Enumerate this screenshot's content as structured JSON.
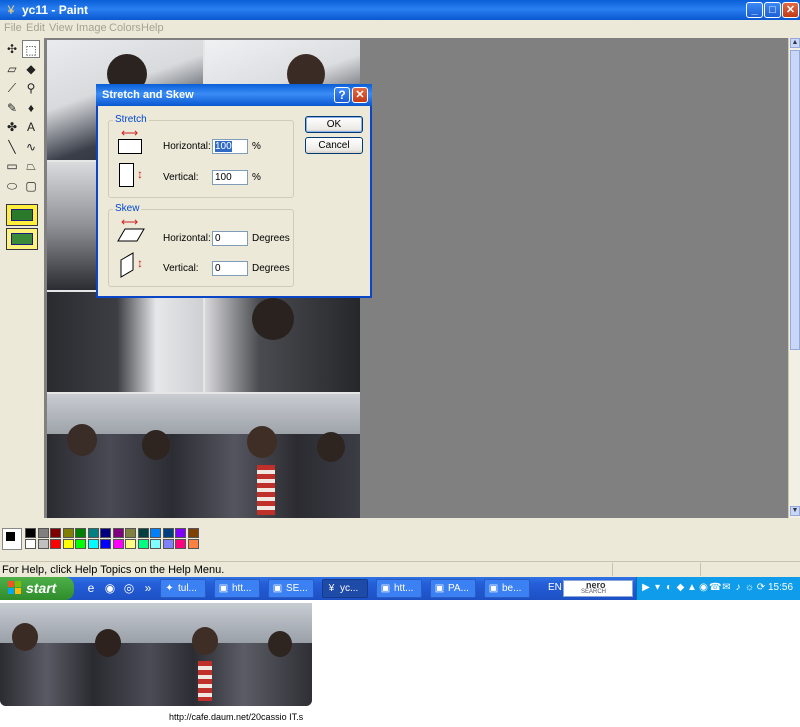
{
  "window": {
    "title": "yc11 - Paint",
    "buttons": {
      "minimize": "_",
      "maximize": "□",
      "close": "✕"
    }
  },
  "menubar": {
    "items": [
      "File",
      "Edit",
      "View",
      "Image",
      "Colors",
      "Help"
    ]
  },
  "toolbox": {
    "tools": [
      {
        "name": "free-form-select-icon",
        "glyph": "✣"
      },
      {
        "name": "select-icon",
        "glyph": "⬚"
      },
      {
        "name": "eraser-icon",
        "glyph": "▱"
      },
      {
        "name": "fill-bucket-icon",
        "glyph": "◆"
      },
      {
        "name": "color-picker-icon",
        "glyph": "⟋"
      },
      {
        "name": "magnifier-icon",
        "glyph": "⚲"
      },
      {
        "name": "pencil-icon",
        "glyph": "✎"
      },
      {
        "name": "brush-icon",
        "glyph": "♦"
      },
      {
        "name": "airbrush-icon",
        "glyph": "✤"
      },
      {
        "name": "text-icon",
        "glyph": "A"
      },
      {
        "name": "line-icon",
        "glyph": "╲"
      },
      {
        "name": "curve-icon",
        "glyph": "∿"
      },
      {
        "name": "rectangle-icon",
        "glyph": "▭"
      },
      {
        "name": "polygon-icon",
        "glyph": "⏢"
      },
      {
        "name": "ellipse-icon",
        "glyph": "⬭"
      },
      {
        "name": "rounded-rectangle-icon",
        "glyph": "▢"
      }
    ]
  },
  "palette": {
    "colors_row1": [
      "#000000",
      "#808080",
      "#800000",
      "#808000",
      "#008000",
      "#008080",
      "#000080",
      "#800080",
      "#808040",
      "#004040",
      "#0080ff",
      "#004080",
      "#8000ff",
      "#804000"
    ],
    "colors_row2": [
      "#ffffff",
      "#c0c0c0",
      "#ff0000",
      "#ffff00",
      "#00ff00",
      "#00ffff",
      "#0000ff",
      "#ff00ff",
      "#ffff80",
      "#00ff80",
      "#80ffff",
      "#8080ff",
      "#ff0080",
      "#ff8040"
    ]
  },
  "status": {
    "text": "For Help, click Help Topics on the Help Menu."
  },
  "dialog": {
    "title": "Stretch and Skew",
    "help_glyph": "?",
    "close_glyph": "✕",
    "stretch": {
      "group_label": "Stretch",
      "horizontal_label": "Horizontal:",
      "horizontal_value": "100",
      "horizontal_unit": "%",
      "vertical_label": "Vertical:",
      "vertical_value": "100",
      "vertical_unit": "%"
    },
    "skew": {
      "group_label": "Skew",
      "horizontal_label": "Horizontal:",
      "horizontal_value": "0",
      "horizontal_unit": "Degrees",
      "vertical_label": "Vertical:",
      "vertical_value": "0",
      "vertical_unit": "Degrees"
    },
    "ok_label": "OK",
    "cancel_label": "Cancel"
  },
  "taskbar": {
    "start_label": "start",
    "quick_launch": [
      {
        "name": "ie-quicklaunch-icon",
        "glyph": "e"
      },
      {
        "name": "firefox-quicklaunch-icon",
        "glyph": "◉"
      },
      {
        "name": "media-quicklaunch-icon",
        "glyph": "◎"
      },
      {
        "name": "more-quicklaunch-icon",
        "glyph": "»"
      }
    ],
    "tasks": [
      {
        "label": "tul...",
        "glyph": "✦",
        "active": false
      },
      {
        "label": "htt...",
        "glyph": "▣",
        "active": false
      },
      {
        "label": "SE...",
        "glyph": "▣",
        "active": false
      },
      {
        "label": "yc...",
        "glyph": "¥",
        "active": true
      },
      {
        "label": "htt...",
        "glyph": "▣",
        "active": false
      },
      {
        "label": "PA...",
        "glyph": "▣",
        "active": false
      },
      {
        "label": "be...",
        "glyph": "▣",
        "active": false
      }
    ],
    "language": "EN",
    "nero_label": "nero",
    "nero_sub": "SEARCH",
    "tray_icons": [
      "▶",
      "▾",
      "◐",
      "◆",
      "▲",
      "◉",
      "☎",
      "✉",
      "♪",
      "☼",
      "⟳"
    ],
    "clock": "15:56"
  },
  "caption": "http://cafe.daum.net/20cassio IT.s"
}
